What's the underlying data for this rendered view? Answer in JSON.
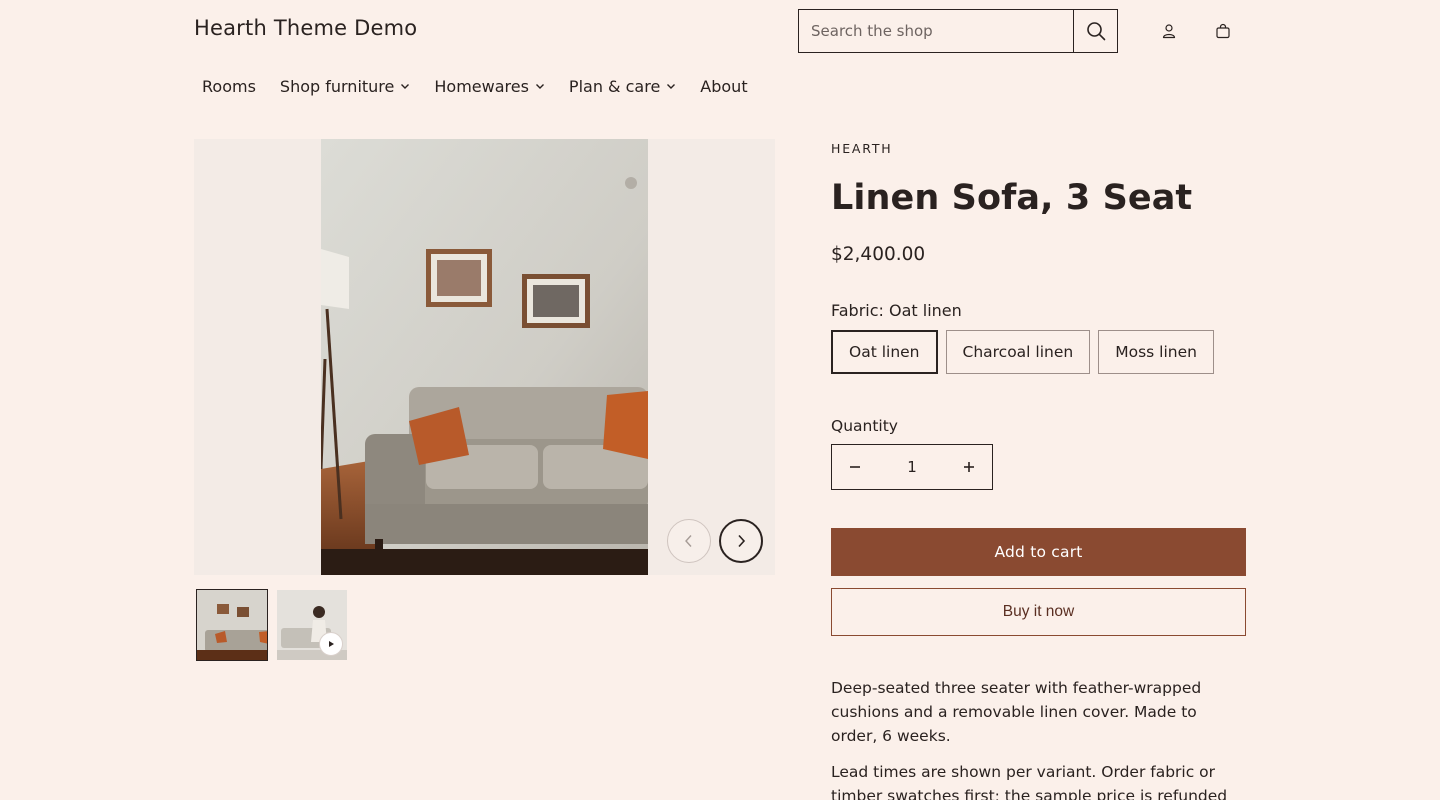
{
  "header": {
    "logo": "Hearth Theme Demo",
    "search_placeholder": "Search the shop"
  },
  "icons": {
    "search": "search-icon",
    "account": "account-icon",
    "cart": "cart-icon"
  },
  "nav": {
    "items": [
      {
        "label": "Rooms",
        "dropdown": false
      },
      {
        "label": "Shop furniture",
        "dropdown": true
      },
      {
        "label": "Homewares",
        "dropdown": true
      },
      {
        "label": "Plan & care",
        "dropdown": true
      },
      {
        "label": "About",
        "dropdown": false
      }
    ]
  },
  "gallery": {
    "thumbnails": [
      "image",
      "video"
    ]
  },
  "product": {
    "vendor": "HEARTH",
    "title": "Linen Sofa, 3 Seat",
    "price": "$2,400.00",
    "option_label": "Fabric: Oat linen",
    "variants": [
      "Oat linen",
      "Charcoal linen",
      "Moss linen"
    ],
    "selected_variant": "Oat linen",
    "quantity_label": "Quantity",
    "quantity": "1",
    "add_to_cart": "Add to cart",
    "buy_now": "Buy it now",
    "description": [
      "Deep-seated three seater with feather-wrapped cushions and a removable linen cover. Made to order, 6 weeks.",
      "Lead times are shown per variant. Order fabric or timber swatches first; the sample price is refunded"
    ]
  },
  "colors": {
    "background": "#fbf0ea",
    "accent": "#8a4a31",
    "text": "#2a2220"
  }
}
